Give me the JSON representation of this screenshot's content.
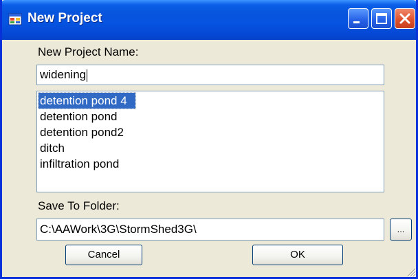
{
  "window": {
    "title": "New Project",
    "app_icon": "window-app-icon",
    "controls": [
      "minimize-icon",
      "maximize-icon",
      "close-icon"
    ]
  },
  "form": {
    "name_label": "New Project Name:",
    "name_value": "widening",
    "projects": [
      {
        "label": "detention pond 4",
        "selected": true
      },
      {
        "label": "detention pond",
        "selected": false
      },
      {
        "label": "detention pond2",
        "selected": false
      },
      {
        "label": "ditch",
        "selected": false
      },
      {
        "label": "infiltration pond",
        "selected": false
      }
    ],
    "folder_label": "Save To Folder:",
    "folder_value": "C:\\AAWork\\3G\\StormShed3G\\",
    "browse_label": "..."
  },
  "buttons": {
    "cancel_label": "Cancel",
    "ok_label": "OK"
  },
  "colors": {
    "titlebar": "#0553e0",
    "selection": "#316ac5",
    "dialog_bg": "#ece9d8"
  }
}
